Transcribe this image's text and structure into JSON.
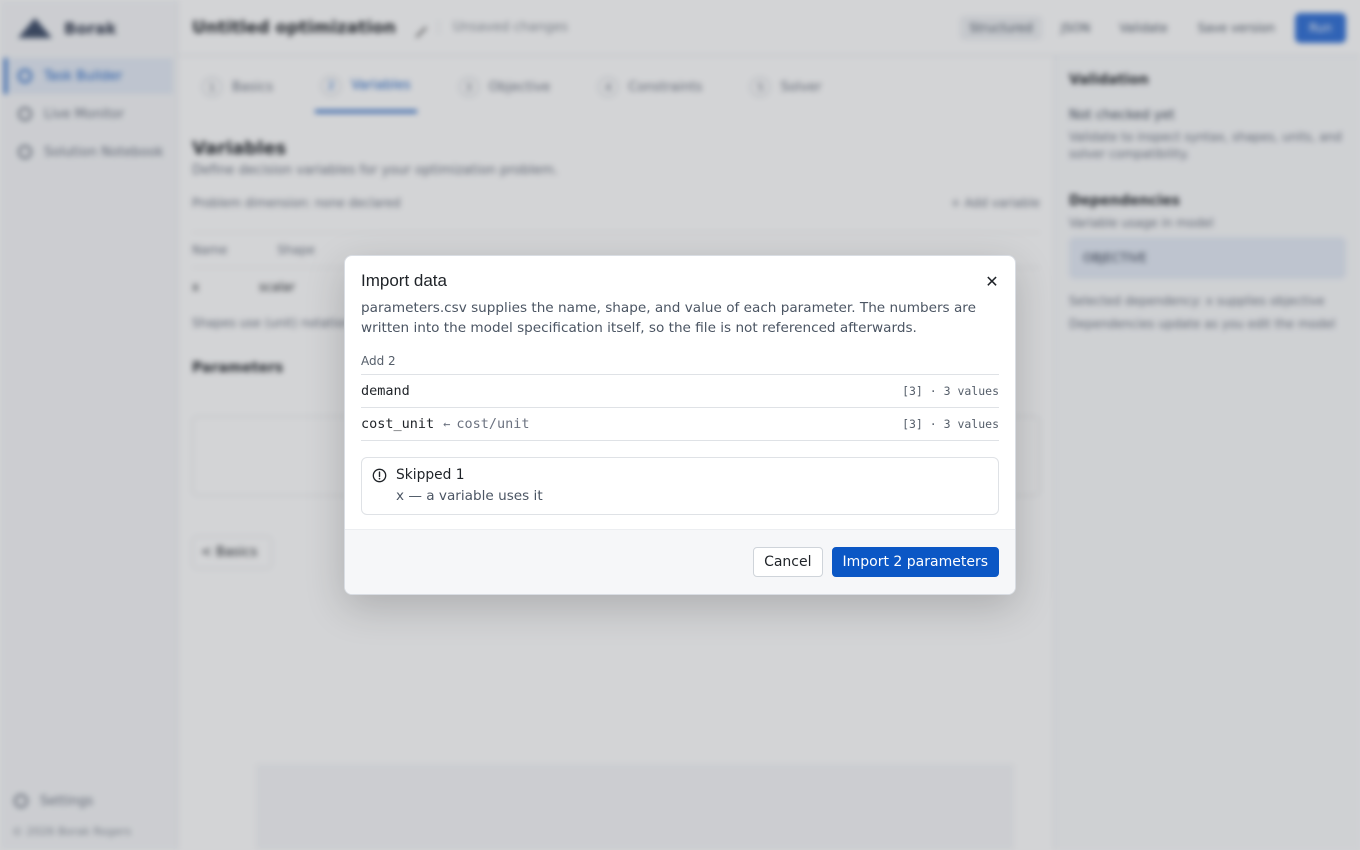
{
  "background": {
    "brand": "Borak",
    "nav": [
      {
        "label": "Task Builder",
        "active": true
      },
      {
        "label": "Live Monitor",
        "active": false
      },
      {
        "label": "Solution Notebook",
        "active": false
      }
    ],
    "settings_label": "Settings",
    "copyright": "© 2026 Borak Rogers",
    "doc_title": "Untitled optimization",
    "unsaved": "Unsaved changes",
    "chips": [
      "Structured",
      "JSON"
    ],
    "validate_label": "Validate",
    "save_label": "Save version",
    "run_label": "Run",
    "steps": [
      {
        "num": "1",
        "label": "Basics",
        "active": false
      },
      {
        "num": "2",
        "label": "Variables",
        "active": true
      },
      {
        "num": "3",
        "label": "Objective",
        "active": false
      },
      {
        "num": "4",
        "label": "Constraints",
        "active": false
      },
      {
        "num": "5",
        "label": "Solver",
        "active": false
      }
    ],
    "section_title": "Variables",
    "section_sub": "Define decision variables for your optimization problem.",
    "dims_label": "Problem dimension: none declared",
    "add_variable": "+ Add variable",
    "table_headers": [
      "Name",
      "Shape"
    ],
    "row_name": "x",
    "row_shape": "scalar",
    "shapes_note": "Shapes use (unit) notation",
    "params_title": "Parameters",
    "back_label": "< Basics",
    "validation_title": "Validation",
    "validation_line": "Not checked yet",
    "validation_small": "Validate to inspect syntax, shapes, units, and solver compatibility.",
    "deps_title": "Dependencies",
    "deps_sub": "Variable usage in model",
    "deps_card": "OBJECTIVE",
    "deps_note1": "Selected dependency: x supplies objective",
    "deps_note2": "Dependencies update as you edit the model"
  },
  "modal": {
    "title": "Import data",
    "close_icon": "close-icon",
    "description": "parameters.csv supplies the name, shape, and value of each parameter. The numbers are written into the model specification itself, so the file is not referenced afterwards.",
    "add_label": "Add 2",
    "rows": [
      {
        "name": "demand",
        "arrow": "",
        "source": "",
        "meta": "[3] · 3 values"
      },
      {
        "name": "cost_unit",
        "arrow": "←",
        "source": "cost/unit",
        "meta": "[3] · 3 values"
      }
    ],
    "skipped_title": "Skipped 1",
    "skipped_item": "x — a variable uses it",
    "cancel_label": "Cancel",
    "import_label": "Import 2 parameters",
    "primary_color": "#0b57c5"
  }
}
